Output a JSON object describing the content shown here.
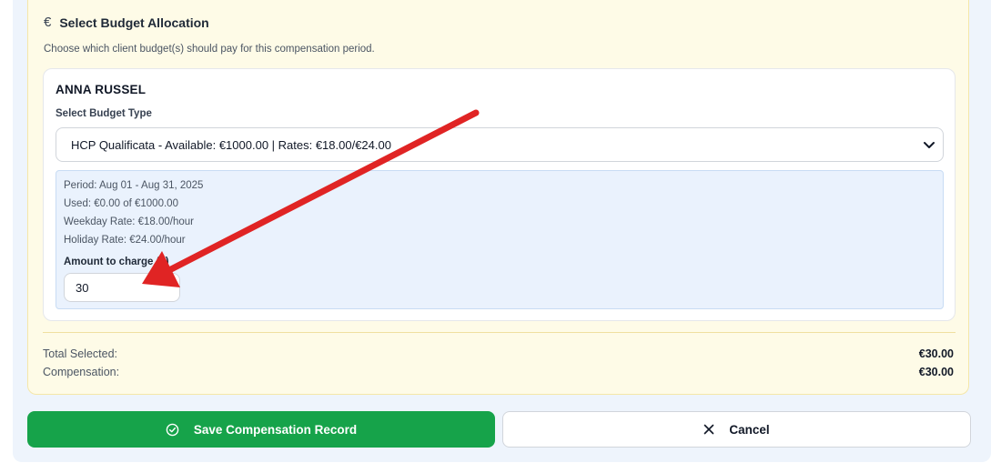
{
  "section": {
    "icon": "euro-icon",
    "title": "Select Budget Allocation",
    "description": "Choose which client budget(s) should pay for this compensation period."
  },
  "client": {
    "name": "ANNA RUSSEL",
    "budget_type_label": "Select Budget Type",
    "selected_budget": "HCP Qualificata - Available: €1000.00 | Rates: €18.00/€24.00",
    "info": {
      "period": "Period: Aug 01 - Aug 31, 2025",
      "used": "Used: €0.00 of €1000.00",
      "weekday_rate": "Weekday Rate: €18.00/hour",
      "holiday_rate": "Holiday Rate: €24.00/hour"
    },
    "amount_label": "Amount to charge (€)",
    "amount_value": "30"
  },
  "summary": {
    "total_label": "Total Selected:",
    "total_value": "€30.00",
    "compensation_label": "Compensation:",
    "compensation_value": "€30.00"
  },
  "buttons": {
    "save_label": "Save Compensation Record",
    "save_icon": "check-circle-icon",
    "cancel_label": "Cancel",
    "cancel_icon": "close-icon"
  },
  "colors": {
    "section_bg": "#fefbe7",
    "info_bg": "#eaf2fd",
    "save_button": "#16a34a",
    "annotation_arrow": "#e02424"
  }
}
